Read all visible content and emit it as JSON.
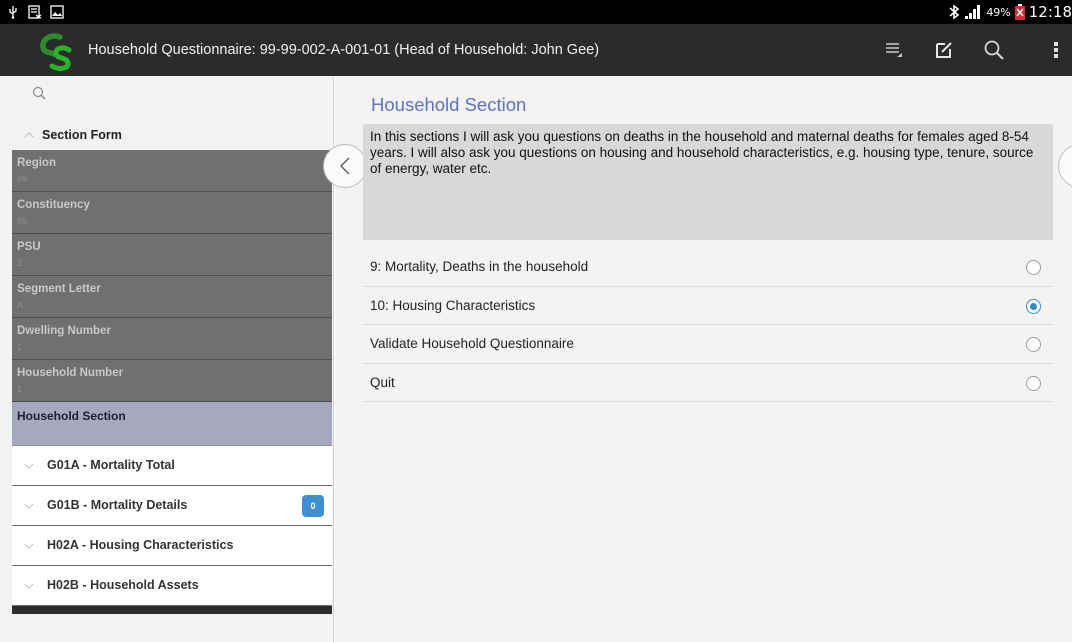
{
  "status_bar": {
    "icons": [
      "usb-icon",
      "debug-icon",
      "image-icon",
      "bluetooth-icon",
      "signal-icon",
      "battery-icon"
    ],
    "battery_percent": "49%",
    "time": "12:18"
  },
  "action_bar": {
    "title": "Household Questionnaire: 99-99-002-A-001-01 (Head of Household: John Gee)",
    "icons": [
      "toc-icon",
      "edit-icon",
      "search-icon",
      "overflow-menu-icon"
    ]
  },
  "sidebar": {
    "section_title": "Section Form",
    "fields": [
      {
        "label": "Region",
        "value": "99"
      },
      {
        "label": "Constituency",
        "value": "99"
      },
      {
        "label": "PSU",
        "value": "2"
      },
      {
        "label": "Segment Letter",
        "value": "A"
      },
      {
        "label": "Dwelling Number",
        "value": "1"
      },
      {
        "label": "Household Number",
        "value": "1"
      }
    ],
    "active_item": "Household Section",
    "groups": [
      {
        "label": "G01A - Mortality Total",
        "badge": ""
      },
      {
        "label": "G01B - Mortality Details",
        "badge": "0"
      },
      {
        "label": "H02A - Housing Characteristics",
        "badge": ""
      },
      {
        "label": "H02B - Household Assets",
        "badge": ""
      }
    ]
  },
  "content": {
    "heading": "Household Section",
    "intro": "In this sections I will ask you questions on deaths in the household and maternal deaths for females aged 8-54 years. I will also ask you questions on housing and household characteristics, e.g. housing type, tenure, source of energy, water etc.",
    "options": [
      {
        "label": "9: Mortality, Deaths in the household",
        "selected": false
      },
      {
        "label": "10: Housing Characteristics",
        "selected": true
      },
      {
        "label": "Validate Household Questionnaire",
        "selected": false
      },
      {
        "label": "Quit",
        "selected": false
      }
    ]
  },
  "colors": {
    "action_bar": "#2b2b2b",
    "heading": "#5a74c8",
    "radio_selected": "#2f8bd8",
    "sidebar_field_bg": "#707070",
    "sidebar_active_bg": "#a6a9bd",
    "badge": "#3f8fd3"
  }
}
